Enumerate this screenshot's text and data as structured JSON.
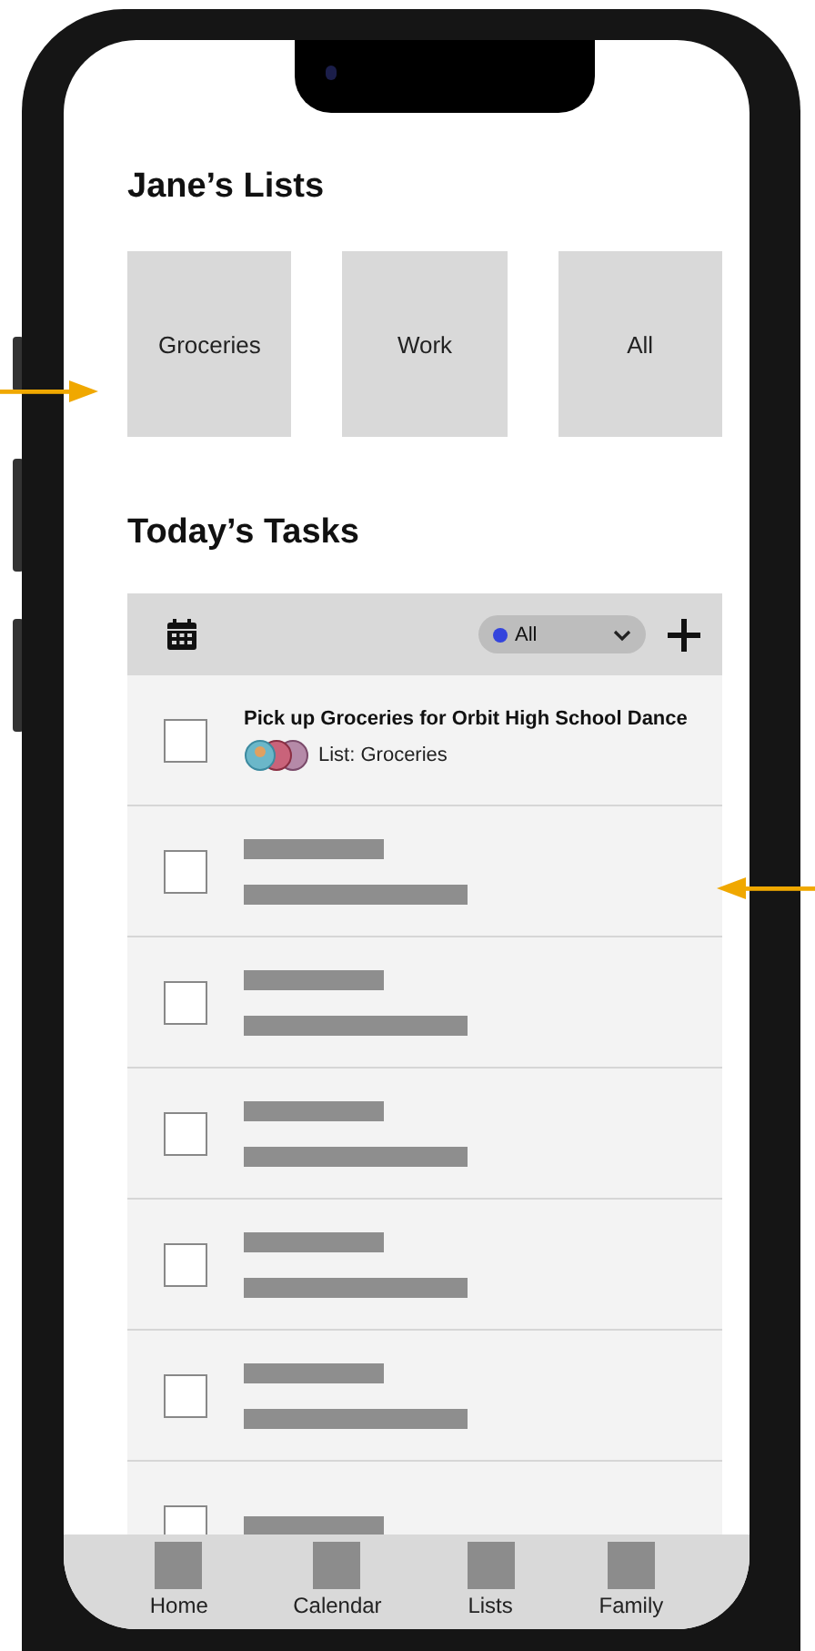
{
  "lists_section": {
    "title": "Jane’s Lists",
    "lists": [
      {
        "label": "Groceries"
      },
      {
        "label": "Work"
      },
      {
        "label": "All"
      }
    ]
  },
  "tasks_section": {
    "title": "Today’s Tasks",
    "filter": {
      "value": "All"
    },
    "tasks": [
      {
        "kind": "task",
        "title": "Pick up Groceries for Orbit High School Dance",
        "list": "List: Groceries",
        "checked": false
      },
      {
        "kind": "placeholder",
        "checked": false
      },
      {
        "kind": "placeholder",
        "checked": false
      },
      {
        "kind": "placeholder",
        "checked": false
      },
      {
        "kind": "placeholder",
        "checked": false
      },
      {
        "kind": "placeholder",
        "checked": false
      },
      {
        "kind": "placeholder_cut",
        "checked": false
      }
    ]
  },
  "tab_bar": [
    {
      "label": "Home"
    },
    {
      "label": "Calendar"
    },
    {
      "label": "Lists"
    },
    {
      "label": "Family"
    }
  ]
}
